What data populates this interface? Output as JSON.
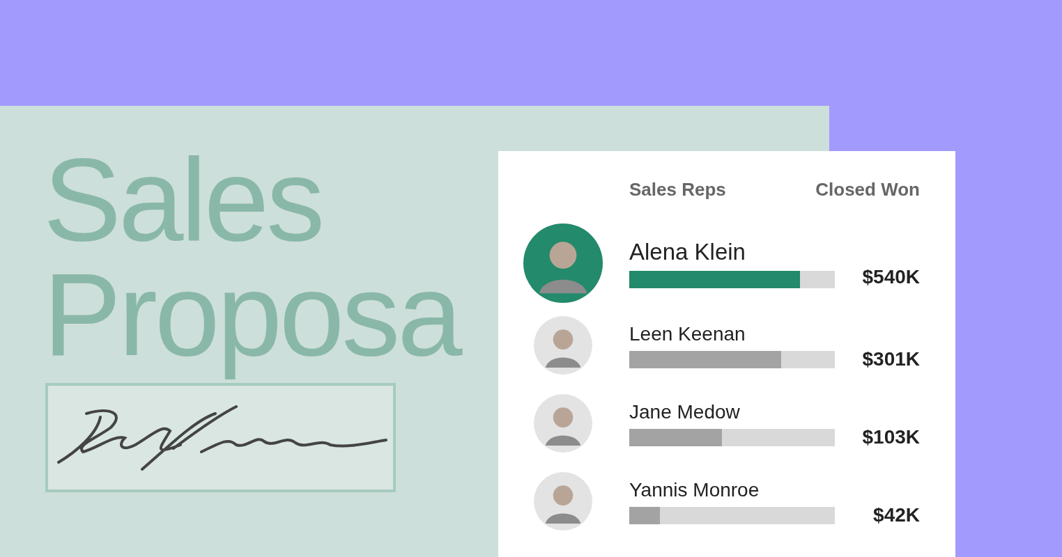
{
  "title": {
    "lines": [
      "Sales",
      "Proposa"
    ]
  },
  "leaderboard": {
    "columns": [
      "Sales Reps",
      "Closed Won"
    ],
    "reps": [
      {
        "name": "Alena Klein",
        "amount": "$540K",
        "level": 0.83,
        "highlighted": true
      },
      {
        "name": "Leen Keenan",
        "amount": "$301K",
        "level": 0.74,
        "highlighted": false
      },
      {
        "name": "Jane Medow",
        "amount": "$103K",
        "level": 0.45,
        "highlighted": false
      },
      {
        "name": "Yannis Monroe",
        "amount": "$42K",
        "level": 0.15,
        "highlighted": false
      }
    ]
  }
}
